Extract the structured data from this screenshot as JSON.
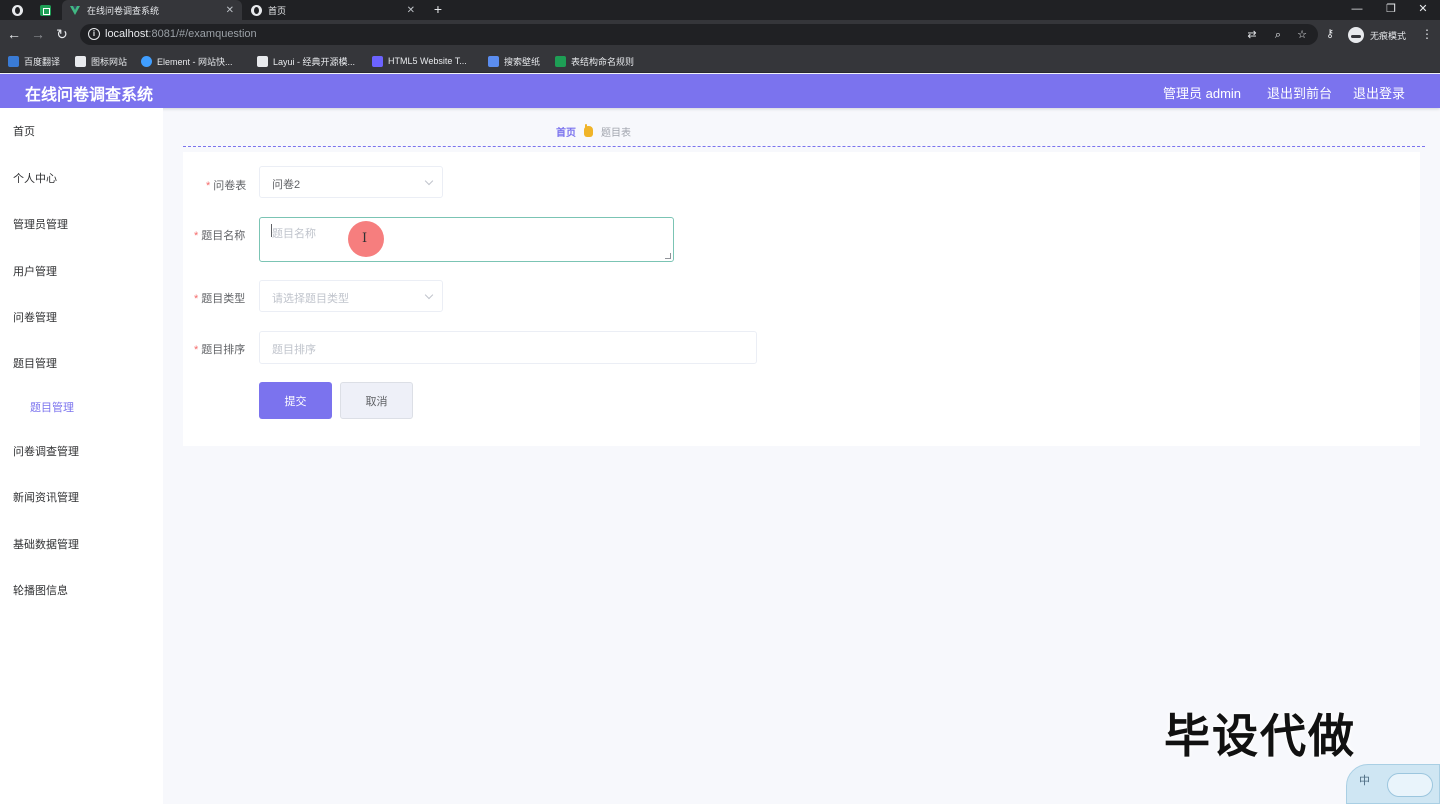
{
  "browser": {
    "tabs": [
      {
        "title": "在线问卷调查系统",
        "active": true
      },
      {
        "title": "首页",
        "active": false
      }
    ],
    "url_host": "localhost",
    "url_rest": ":8081/#/examquestion",
    "incognito_label": "无痕模式",
    "bookmarks": [
      {
        "label": "百度翻译",
        "icon": "translate-icon",
        "color": "#3a7bd5"
      },
      {
        "label": "图标网站",
        "icon": "flag-icon",
        "color": "#e8eaed"
      },
      {
        "label": "Element - 网站快...",
        "icon": "element-icon",
        "color": "#409eff"
      },
      {
        "label": "Layui - 经典开源模...",
        "icon": "layui-icon",
        "color": "#e8eaed"
      },
      {
        "label": "HTML5 Website T...",
        "icon": "html5-icon",
        "color": "#6c63ff"
      },
      {
        "label": "搜索壁纸",
        "icon": "wallpaper-icon",
        "color": "#5b8def"
      },
      {
        "label": "表结构命名规则",
        "icon": "sheet-icon",
        "color": "#1e9e55"
      }
    ]
  },
  "header": {
    "title": "在线问卷调查系统",
    "admin_label": "管理员 admin",
    "front_label": "退出到前台",
    "logout_label": "退出登录",
    "color": "#7b73ee"
  },
  "sidebar": {
    "items": [
      {
        "label": "首页"
      },
      {
        "label": "个人中心"
      },
      {
        "label": "管理员管理"
      },
      {
        "label": "用户管理"
      },
      {
        "label": "问卷管理"
      },
      {
        "label": "题目管理"
      },
      {
        "label": "题目管理"
      },
      {
        "label": "问卷调查管理"
      },
      {
        "label": "新闻资讯管理"
      },
      {
        "label": "基础数据管理"
      },
      {
        "label": "轮播图信息"
      }
    ]
  },
  "breadcrumb": {
    "home": "首页",
    "current": "题目表"
  },
  "form": {
    "required_mark": "*",
    "survey": {
      "label": "问卷表",
      "value": "问卷2"
    },
    "question_name": {
      "label": "题目名称",
      "placeholder": "题目名称"
    },
    "question_type": {
      "label": "题目类型",
      "placeholder": "请选择题目类型"
    },
    "question_order": {
      "label": "题目排序",
      "placeholder": "题目排序"
    },
    "submit_label": "提交",
    "cancel_label": "取消"
  },
  "overlay": {
    "watermark": "毕设代做",
    "ime_label": "中"
  }
}
